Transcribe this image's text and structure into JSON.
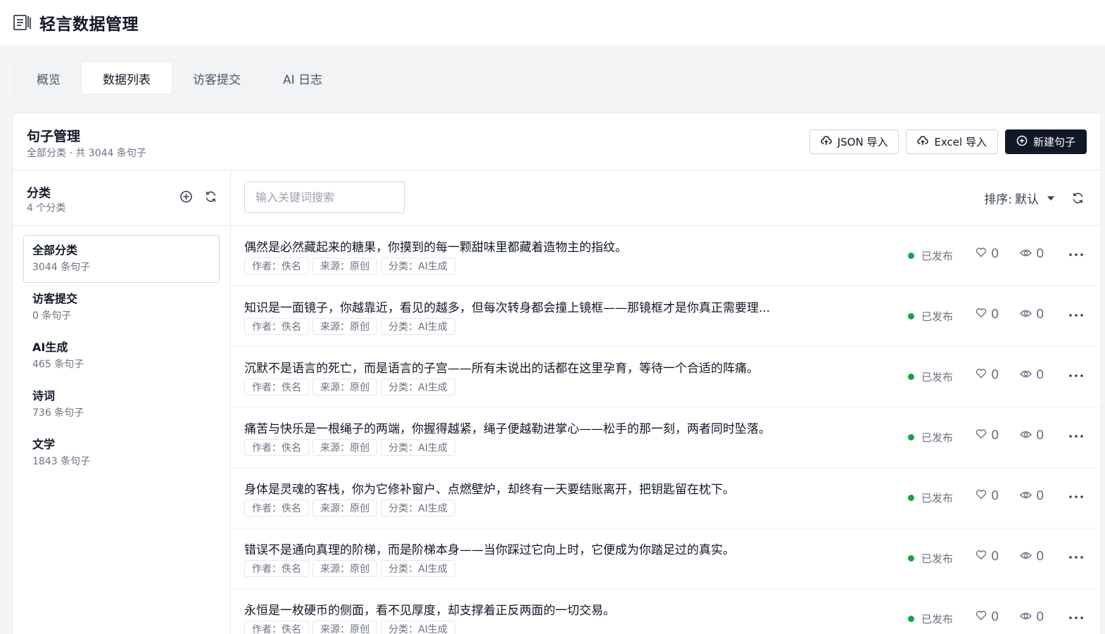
{
  "app": {
    "title": "轻言数据管理",
    "logo_icon": "book-icon"
  },
  "tabs": [
    {
      "label": "概览",
      "active": false
    },
    {
      "label": "数据列表",
      "active": true
    },
    {
      "label": "访客提交",
      "active": false
    },
    {
      "label": "AI 日志",
      "active": false
    }
  ],
  "card": {
    "title": "句子管理",
    "subtitle": "全部分类 · 共 3044 条句子",
    "actions": {
      "json_import": "JSON 导入",
      "excel_import": "Excel 导入",
      "new_sentence": "新建句子"
    }
  },
  "sidebar": {
    "title": "分类",
    "count": "4 个分类",
    "categories": [
      {
        "name": "全部分类",
        "count": "3044 条句子",
        "active": true
      },
      {
        "name": "访客提交",
        "count": "0 条句子",
        "active": false
      },
      {
        "name": "AI生成",
        "count": "465 条句子",
        "active": false
      },
      {
        "name": "诗词",
        "count": "736 条句子",
        "active": false
      },
      {
        "name": "文学",
        "count": "1843 条句子",
        "active": false
      }
    ]
  },
  "toolbar": {
    "search_placeholder": "输入关键词搜索",
    "sort_label": "排序:",
    "sort_value": "默认"
  },
  "rows": [
    {
      "text": "偶然是必然藏起来的糖果，你摸到的每一颗甜味里都藏着造物主的指纹。",
      "author": "作者：佚名",
      "source": "来源：原创",
      "category": "分类：AI生成",
      "status": "已发布",
      "likes": "0",
      "views": "0"
    },
    {
      "text": "知识是一面镜子，你越靠近，看见的越多，但每次转身都会撞上镜框——那镜框才是你真正需要理...",
      "author": "作者：佚名",
      "source": "来源：原创",
      "category": "分类：AI生成",
      "status": "已发布",
      "likes": "0",
      "views": "0"
    },
    {
      "text": "沉默不是语言的死亡，而是语言的子宫——所有未说出的话都在这里孕育，等待一个合适的阵痛。",
      "author": "作者：佚名",
      "source": "来源：原创",
      "category": "分类：AI生成",
      "status": "已发布",
      "likes": "0",
      "views": "0"
    },
    {
      "text": "痛苦与快乐是一根绳子的两端，你握得越紧，绳子便越勒进掌心——松手的那一刻，两者同时坠落。",
      "author": "作者：佚名",
      "source": "来源：原创",
      "category": "分类：AI生成",
      "status": "已发布",
      "likes": "0",
      "views": "0"
    },
    {
      "text": "身体是灵魂的客栈，你为它修补窗户、点燃壁炉，却终有一天要结账离开，把钥匙留在枕下。",
      "author": "作者：佚名",
      "source": "来源：原创",
      "category": "分类：AI生成",
      "status": "已发布",
      "likes": "0",
      "views": "0"
    },
    {
      "text": "错误不是通向真理的阶梯，而是阶梯本身——当你踩过它向上时，它便成为你踏足过的真实。",
      "author": "作者：佚名",
      "source": "来源：原创",
      "category": "分类：AI生成",
      "status": "已发布",
      "likes": "0",
      "views": "0"
    },
    {
      "text": "永恒是一枚硬币的侧面，看不见厚度，却支撑着正反两面的一切交易。",
      "author": "作者：佚名",
      "source": "来源：原创",
      "category": "分类：AI生成",
      "status": "已发布",
      "likes": "0",
      "views": "0"
    }
  ],
  "colors": {
    "primary": "#111827",
    "published": "#16a34a",
    "border": "#e5e7eb"
  }
}
